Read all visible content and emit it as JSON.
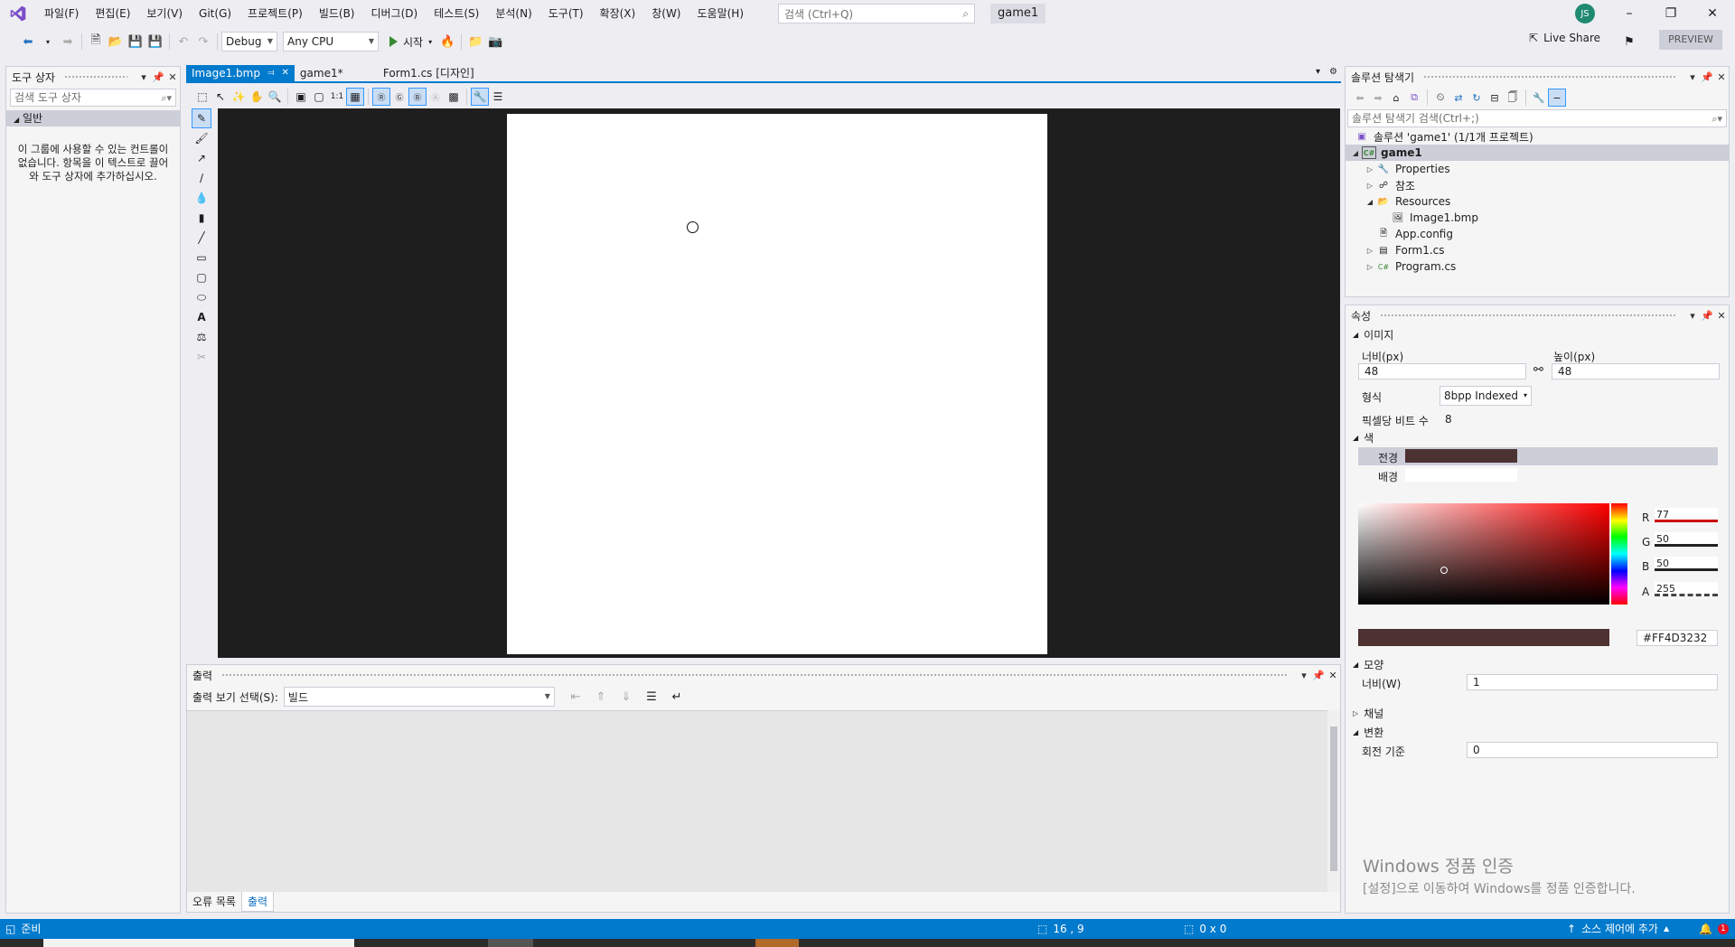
{
  "menu": {
    "items": [
      "파일(F)",
      "편집(E)",
      "보기(V)",
      "Git(G)",
      "프로젝트(P)",
      "빌드(B)",
      "디버그(D)",
      "테스트(S)",
      "분석(N)",
      "도구(T)",
      "확장(X)",
      "창(W)",
      "도움말(H)"
    ],
    "search_placeholder": "검색 (Ctrl+Q)",
    "solution_name": "game1",
    "avatar_initials": "JS"
  },
  "toolbar": {
    "config": "Debug",
    "platform": "Any CPU",
    "start_label": "시작",
    "liveshare_label": "Live Share",
    "preview_label": "PREVIEW"
  },
  "toolbox": {
    "title": "도구 상자",
    "search_placeholder": "검색 도구 상자",
    "group": "일반",
    "empty_text": "이 그룹에 사용할 수 있는 컨트롤이 없습니다. 항목을 이 텍스트로 끌어와 도구 상자에 추가하십시오."
  },
  "editor": {
    "tabs": [
      {
        "label": "Image1.bmp",
        "active": true
      },
      {
        "label": "game1*",
        "active": false
      },
      {
        "label": "Form1.cs [디자인]",
        "active": false
      }
    ]
  },
  "output": {
    "title": "출력",
    "show_label": "출력 보기 선택(S):",
    "show_value": "빌드",
    "bottom_tabs": [
      "오류 목록",
      "출력"
    ]
  },
  "solution_explorer": {
    "title": "솔루션 탐색기",
    "search_placeholder": "솔루션 탐색기 검색(Ctrl+;)",
    "root": "솔루션 'game1' (1/1개 프로젝트)",
    "items": [
      {
        "label": "game1",
        "selected": true
      },
      {
        "label": "Properties"
      },
      {
        "label": "참조"
      },
      {
        "label": "Resources"
      },
      {
        "label": "Image1.bmp"
      },
      {
        "label": "App.config"
      },
      {
        "label": "Form1.cs"
      },
      {
        "label": "Program.cs"
      }
    ]
  },
  "properties": {
    "title": "속성",
    "image_section": "이미지",
    "width_label": "너비(px)",
    "width_value": "48",
    "height_label": "높이(px)",
    "height_value": "48",
    "format_label": "형식",
    "format_value": "8bpp Indexed",
    "bpp_label": "픽셀당 비트 수",
    "bpp_value": "8",
    "color_section": "색",
    "fore_label": "전경",
    "fore_color": "#4D3232",
    "back_label": "배경",
    "r_label": "R",
    "r_value": "77",
    "g_label": "G",
    "g_value": "50",
    "b_label": "B",
    "b_value": "50",
    "a_label": "A",
    "a_value": "255",
    "hex_value": "#FF4D3232",
    "shape_section": "모양",
    "line_width_label": "너비(W)",
    "line_width_value": "1",
    "channel_section": "채널",
    "transform_section": "변환",
    "rotation_label": "회전 기준",
    "rotation_value": "0"
  },
  "watermark": {
    "line1": "Windows 정품 인증",
    "line2": "[설정]으로 이동하여 Windows를 정품 인증합니다."
  },
  "status": {
    "ready": "준비",
    "position": "16 , 9",
    "selection": "0 x 0",
    "source_control": "소스 제어에 추가",
    "notifications": "1"
  },
  "colors": {
    "accent": "#007acc",
    "canvas_bg": "#1e1e1e",
    "ide_bg": "#eeeef2"
  }
}
